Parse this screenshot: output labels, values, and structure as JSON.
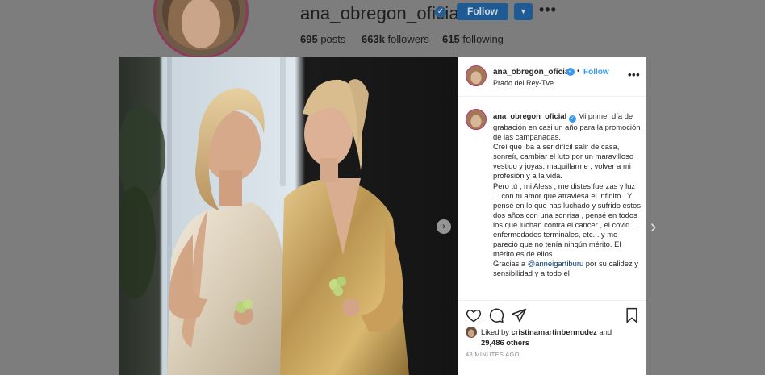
{
  "profile": {
    "username": "ana_obregon_oficial",
    "follow_label": "Follow",
    "stats": [
      {
        "count": "695",
        "label": "posts"
      },
      {
        "count": "663k",
        "label": "followers"
      },
      {
        "count": "615",
        "label": "following"
      }
    ]
  },
  "post": {
    "username": "ana_obregon_oficial",
    "follow_label": "Follow",
    "location": "Prado del Rey-Tve",
    "separator": "•",
    "caption_lines": [
      "Mi primer día de grabación en casi un año para la promoción de las campanadas.",
      "Creí que iba a ser difícil salir de casa, sonreír, cambiar el luto por un maravilloso vestido y joyas, maquillarme , volver a mi profesión y a la vida.",
      "Pero tú , mi Aless , me distes fuerzas y luz ... con tu amor que atraviesa el infinito . Y pensé en lo que has luchado y sufrido estos dos años con una sonrisa , pensé en todos los que luchan contra el cancer , el covid , enfermedades terminales, etc... y me pareció que no tenía ningún mérito. El mérito es de ellos."
    ],
    "caption_thanks_prefix": "Gracias a ",
    "caption_mention": "@anneigartiburu",
    "caption_thanks_suffix": " por su calidez y sensibilidad y a todo el",
    "liked_by_prefix": "Liked by ",
    "liked_by_user": "cristinamartinbermudez",
    "liked_by_and": " and",
    "likes_count": "29,486 others",
    "timestamp": "48 MINUTES AGO"
  },
  "colors": {
    "accent_blue": "#3897f0",
    "dim_follow": "#1f5a93",
    "story_ring": "#c0306c"
  },
  "icons": [
    "verified-badge-icon",
    "chevron-down-icon",
    "more-options-icon",
    "heart-icon",
    "comment-icon",
    "share-icon",
    "bookmark-icon",
    "chevron-right-icon"
  ]
}
